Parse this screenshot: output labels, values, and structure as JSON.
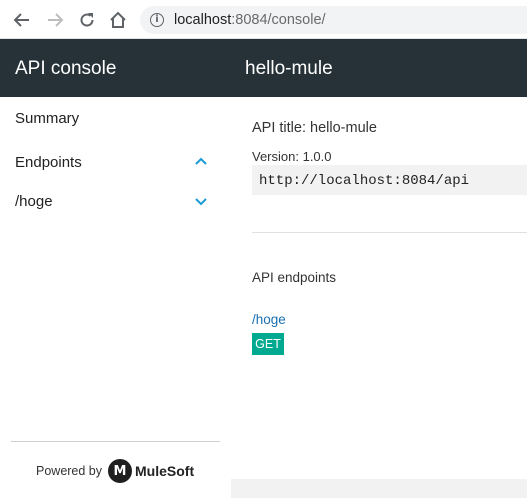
{
  "browser": {
    "url_host": "localhost",
    "url_path": ":8084/console/"
  },
  "header": {
    "app_title": "API console",
    "page_title": "hello-mule"
  },
  "sidebar": {
    "items": [
      {
        "label": "Summary"
      },
      {
        "label": "Endpoints",
        "chevron": "chevron-up-icon"
      },
      {
        "label": "/hoge",
        "chevron": "chevron-down-icon"
      }
    ],
    "powered_by": "Powered by",
    "brand": "MuleSoft"
  },
  "main": {
    "api_title": "API title: hello-mule",
    "version": "Version: 1.0.0",
    "base_uri": "http://localhost:8084/api",
    "endpoints_heading": "API endpoints",
    "endpoints": [
      {
        "path": "/hoge",
        "methods": [
          "GET"
        ]
      }
    ]
  },
  "colors": {
    "header_bg": "#263238",
    "accent": "#1a9bd7",
    "get_badge": "#00a98f",
    "link": "#1a6fb0"
  }
}
